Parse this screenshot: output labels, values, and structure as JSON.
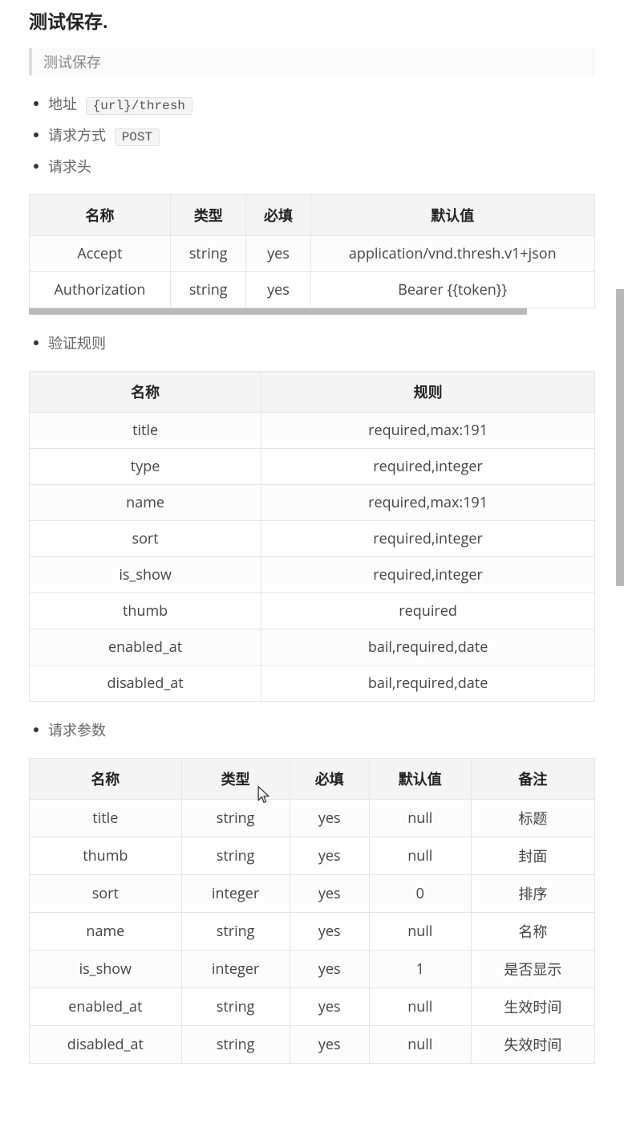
{
  "heading": "测试保存.",
  "description": "测试保存",
  "endpoint": {
    "label_addr": "地址",
    "addr_code": "{url}/thresh",
    "label_method": "请求方式",
    "method_code": "POST",
    "label_headers": "请求头",
    "label_rules": "验证规则",
    "label_params": "请求参数"
  },
  "headers_table": {
    "cols": [
      "名称",
      "类型",
      "必填",
      "默认值"
    ],
    "rows": [
      [
        "Accept",
        "string",
        "yes",
        "application/vnd.thresh.v1+json"
      ],
      [
        "Authorization",
        "string",
        "yes",
        "Bearer {{token}}"
      ]
    ]
  },
  "rules_table": {
    "cols": [
      "名称",
      "规则"
    ],
    "rows": [
      [
        "title",
        "required,max:191"
      ],
      [
        "type",
        "required,integer"
      ],
      [
        "name",
        "required,max:191"
      ],
      [
        "sort",
        "required,integer"
      ],
      [
        "is_show",
        "required,integer"
      ],
      [
        "thumb",
        "required"
      ],
      [
        "enabled_at",
        "bail,required,date"
      ],
      [
        "disabled_at",
        "bail,required,date"
      ]
    ]
  },
  "params_table": {
    "cols": [
      "名称",
      "类型",
      "必填",
      "默认值",
      "备注"
    ],
    "rows": [
      [
        "title",
        "string",
        "yes",
        "null",
        "标题"
      ],
      [
        "thumb",
        "string",
        "yes",
        "null",
        "封面"
      ],
      [
        "sort",
        "integer",
        "yes",
        "0",
        "排序"
      ],
      [
        "name",
        "string",
        "yes",
        "null",
        "名称"
      ],
      [
        "is_show",
        "integer",
        "yes",
        "1",
        "是否显示"
      ],
      [
        "enabled_at",
        "string",
        "yes",
        "null",
        "生效时间"
      ],
      [
        "disabled_at",
        "string",
        "yes",
        "null",
        "失效时间"
      ]
    ]
  }
}
